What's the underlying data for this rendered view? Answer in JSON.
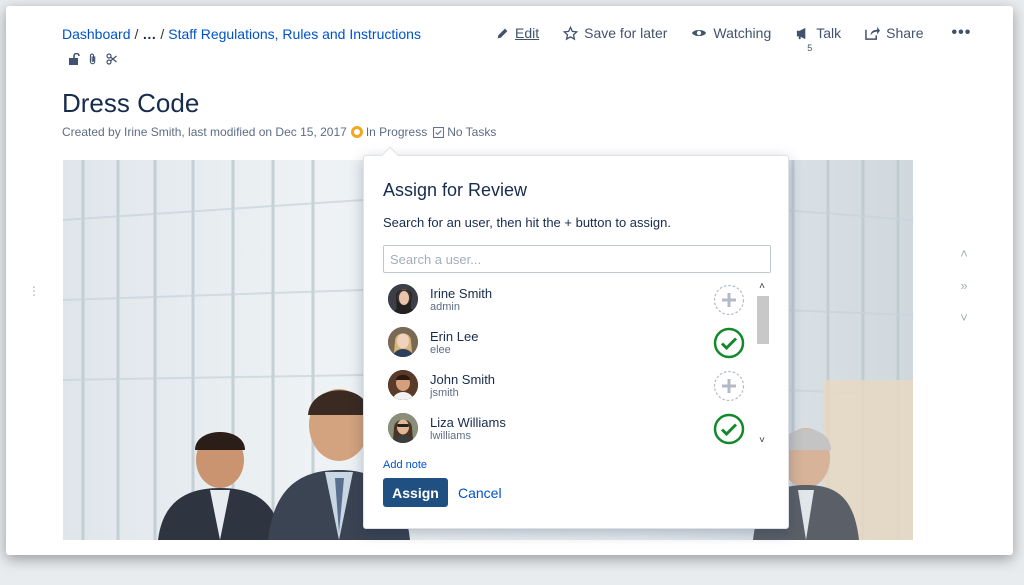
{
  "breadcrumb": {
    "root": "Dashboard",
    "ellipsis": "…",
    "parent": "Staff Regulations, Rules and Instructions"
  },
  "actions": {
    "edit": "Edit",
    "save": "Save for later",
    "watching": "Watching",
    "talk": "Talk",
    "talk_count": "5",
    "share": "Share",
    "more": "•••"
  },
  "page": {
    "title": "Dress Code",
    "byline": "Created by Irine Smith, last modified on Dec 15, 2017",
    "status": "In Progress",
    "tasks": "No Tasks"
  },
  "dialog": {
    "title": "Assign for Review",
    "description": "Search for an user, then hit the + button to assign.",
    "search_placeholder": "Search a user...",
    "users": [
      {
        "name": "Irine Smith",
        "login": "admin",
        "assigned": false
      },
      {
        "name": "Erin Lee",
        "login": "elee",
        "assigned": true
      },
      {
        "name": "John Smith",
        "login": "jsmith",
        "assigned": false
      },
      {
        "name": "Liza Williams",
        "login": "lwilliams",
        "assigned": true
      }
    ],
    "add_note": "Add note",
    "assign_label": "Assign",
    "cancel_label": "Cancel"
  },
  "colors": {
    "link": "#0052cc",
    "primary_button": "#205081",
    "assigned_check": "#14892c",
    "status_in_progress": "#f5a623"
  },
  "icons": [
    "pencil-icon",
    "star-icon",
    "eye-icon",
    "megaphone-icon",
    "share-icon",
    "lock-icon",
    "paperclip-icon",
    "scissors-icon",
    "plus-icon",
    "check-icon"
  ]
}
